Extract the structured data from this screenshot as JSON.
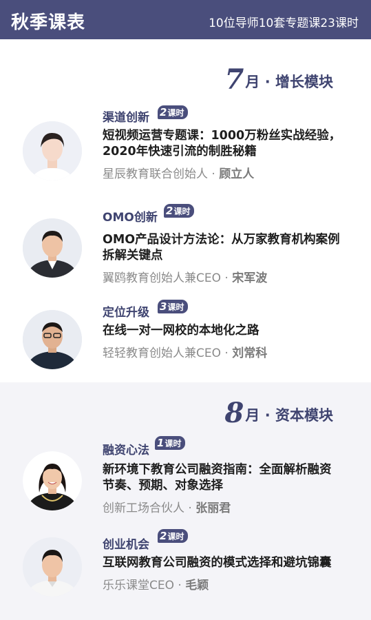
{
  "header": {
    "title": "秋季课表",
    "subtitle": "10位导师10套专题课23课时"
  },
  "sections": [
    {
      "month_num": "7",
      "month_label": "月 · 增长模块",
      "courses": [
        {
          "category": "渠道创新",
          "hours": "2",
          "hours_unit": "课时",
          "title_line1": "短视频运营专题课：1000万粉丝实战经验，",
          "title_line2": "2020年快速引流的制胜秘籍",
          "speaker_role": "星辰教育联合创始人 · ",
          "speaker_name": "顾立人"
        },
        {
          "category": "OMO创新",
          "hours": "2",
          "hours_unit": "课时",
          "title_line1": "OMO产品设计方法论：从万家教育机构案例",
          "title_line2": "拆解关键点",
          "speaker_role": "翼鸥教育创始人兼CEO · ",
          "speaker_name": "宋军波"
        },
        {
          "category": "定位升级",
          "hours": "3",
          "hours_unit": "课时",
          "title_line1": "在线一对一网校的本地化之路",
          "title_line2": "",
          "speaker_role": "轻轻教育创始人兼CEO · ",
          "speaker_name": "刘常科"
        }
      ]
    },
    {
      "month_num": "8",
      "month_label": "月 · 资本模块",
      "courses": [
        {
          "category": "融资心法",
          "hours": "1",
          "hours_unit": "课时",
          "title_line1": "新环境下教育公司融资指南：全面解析融资",
          "title_line2": "节奏、预期、对象选择",
          "speaker_role": "创新工场合伙人 · ",
          "speaker_name": "张丽君"
        },
        {
          "category": "创业机会",
          "hours": "2",
          "hours_unit": "课时",
          "title_line1": "互联网教育公司融资的模式选择和避坑锦囊",
          "title_line2": "",
          "speaker_role": "乐乐课堂CEO · ",
          "speaker_name": "毛颖"
        }
      ]
    }
  ],
  "colors": {
    "brand": "#4a4e7c",
    "accent_text": "#3f4470",
    "speaker_text": "#8a8a8a",
    "section2_bg": "#f4f4f8"
  },
  "icons": [
    "avatar-portrait"
  ]
}
